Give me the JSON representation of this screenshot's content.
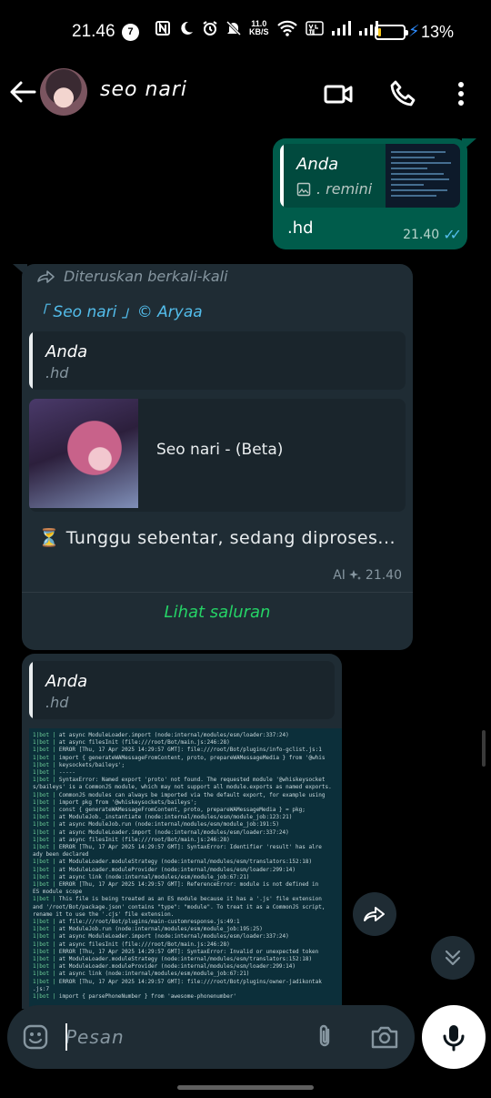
{
  "status_bar": {
    "time": "21.46",
    "notification_count": "7",
    "network_speed_value": "11.0",
    "network_speed_unit": "KB/S",
    "battery_level": 0.13,
    "battery_percent": "13%",
    "icons": [
      "nfc-icon",
      "moon-icon",
      "alarm-icon",
      "mute-icon",
      "wifi-icon",
      "volte-icon",
      "signal-icon",
      "signal-icon",
      "battery-icon",
      "charging-icon"
    ]
  },
  "header": {
    "contact_name": "seo nari",
    "icons": [
      "back-arrow-icon",
      "video-call-icon",
      "phone-icon",
      "more-vert-icon"
    ]
  },
  "messages": {
    "outgoing": {
      "quote_name": "Anda",
      "quote_text": ". remini",
      "body": ".hd",
      "time": "21.40"
    },
    "forwarded": {
      "forward_label": "Diteruskan berkali-kali",
      "channel_name": "「 Seo nari 」© Aryaa",
      "quote_name": "Anda",
      "quote_text": ".hd",
      "preview_title": "Seo nari - (Beta)",
      "body": "⏳ Tunggu sebentar, sedang diproses...",
      "ai_label": "AI",
      "time": "21.40",
      "see_channel": "Lihat saluran"
    },
    "second": {
      "quote_name": "Anda",
      "quote_text": ".hd"
    }
  },
  "code_screenshot": [
    {
      "tag": "1|bot",
      "text": "    at async ModuleLoader.import (node:internal/modules/esm/loader:337:24)"
    },
    {
      "tag": "1|bot",
      "text": "    at async filesInit (file:///root/Bot/main.js:246:28)"
    },
    {
      "tag": "1|bot",
      "text": "ERROR  [Thu, 17 Apr 2025 14:29:57 GMT]: file:///root/Bot/plugins/info-gclist.js:1"
    },
    {
      "tag": "1|bot",
      "text": "import { generateWAMessageFromContent, proto, prepareWAMessageMedia } from '@whis"
    },
    {
      "tag": "1|bot",
      "text": "keysockets/baileys';"
    },
    {
      "tag": "1|bot",
      "text": "                                   -----"
    },
    {
      "tag": "1|bot",
      "text": "SyntaxError: Named export 'proto' not found. The requested module '@whiskeysocket"
    },
    {
      "tag": "",
      "text": "s/baileys' is a CommonJS module, which may not support all module.exports as named exports."
    },
    {
      "tag": "1|bot",
      "text": "CommonJS modules can always be imported via the default export, for example using"
    },
    {
      "tag": "1|bot",
      "text": "import pkg from '@whiskeysockets/baileys';"
    },
    {
      "tag": "1|bot",
      "text": "const { generateWAMessageFromContent, proto, prepareWAMessageMedia } = pkg;"
    },
    {
      "tag": "1|bot",
      "text": "    at ModuleJob._instantiate (node:internal/modules/esm/module_job:123:21)"
    },
    {
      "tag": "1|bot",
      "text": "    at async ModuleJob.run (node:internal/modules/esm/module_job:191:5)"
    },
    {
      "tag": "1|bot",
      "text": "    at async ModuleLoader.import (node:internal/modules/esm/loader:337:24)"
    },
    {
      "tag": "1|bot",
      "text": "    at async filesInit (file:///root/Bot/main.js:246:28)"
    },
    {
      "tag": "1|bot",
      "text": "ERROR  [Thu, 17 Apr 2025 14:29:57 GMT]: SyntaxError: Identifier 'result' has alre"
    },
    {
      "tag": "",
      "text": "ady been declared"
    },
    {
      "tag": "1|bot",
      "text": "    at ModuleLoader.moduleStrategy (node:internal/modules/esm/translators:152:18)"
    },
    {
      "tag": "1|bot",
      "text": "    at ModuleLoader.moduleProvider (node:internal/modules/esm/loader:299:14)"
    },
    {
      "tag": "1|bot",
      "text": "    at async link (node:internal/modules/esm/module_job:67:21)"
    },
    {
      "tag": "1|bot",
      "text": "ERROR  [Thu, 17 Apr 2025 14:29:57 GMT]: ReferenceError: module is not defined in"
    },
    {
      "tag": "",
      "text": "ES module scope"
    },
    {
      "tag": "1|bot",
      "text": "This file is being treated as an ES module because it has a '.js' file extension"
    },
    {
      "tag": "",
      "text": "and '/root/Bot/package.json' contains \"type\": \"module\". To treat it as a CommonJS script,"
    },
    {
      "tag": "",
      "text": "rename it to use the '.cjs' file extension."
    },
    {
      "tag": "1|bot",
      "text": "    at file:///root/Bot/plugins/main-customresponse.js:49:1"
    },
    {
      "tag": "1|bot",
      "text": "    at ModuleJob.run (node:internal/modules/esm/module_job:195:25)"
    },
    {
      "tag": "1|bot",
      "text": "    at async ModuleLoader.import (node:internal/modules/esm/loader:337:24)"
    },
    {
      "tag": "1|bot",
      "text": "    at async filesInit (file:///root/Bot/main.js:246:28)"
    },
    {
      "tag": "1|bot",
      "text": "ERROR  [Thu, 17 Apr 2025 14:29:57 GMT]: SyntaxError: Invalid or unexpected token"
    },
    {
      "tag": "1|bot",
      "text": "    at ModuleLoader.moduleStrategy (node:internal/modules/esm/translators:152:18)"
    },
    {
      "tag": "1|bot",
      "text": "    at ModuleLoader.moduleProvider (node:internal/modules/esm/loader:299:14)"
    },
    {
      "tag": "1|bot",
      "text": "    at async link (node:internal/modules/esm/module_job:67:21)"
    },
    {
      "tag": "1|bot",
      "text": "ERROR  [Thu, 17 Apr 2025 14:29:57 GMT]: file:///root/Bot/plugins/owner-jadikontak"
    },
    {
      "tag": "",
      "text": ".js:7"
    },
    {
      "tag": "1|bot",
      "text": "import { parsePhoneNumber } from 'awesome-phonenumber'"
    }
  ],
  "composer": {
    "placeholder": "Pesan",
    "icons": [
      "emoji-icon",
      "attach-icon",
      "camera-icon",
      "mic-icon"
    ]
  },
  "colors": {
    "background": "#000000",
    "outgoing_bubble": "#005c4b",
    "incoming_bubble": "#1f2c34",
    "accent_green": "#25d366",
    "read_ticks": "#53bdeb"
  }
}
